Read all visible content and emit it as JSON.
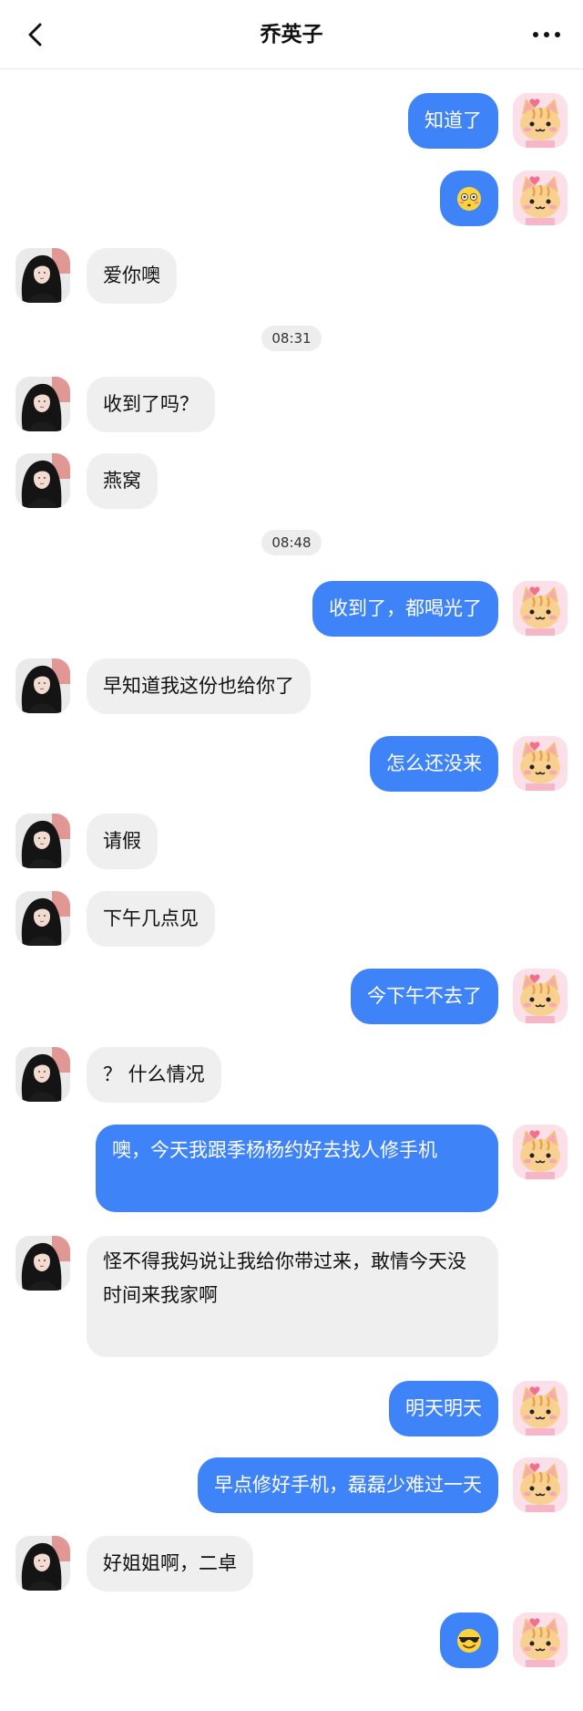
{
  "header": {
    "title": "乔英子"
  },
  "accent_color": "#3e83f8",
  "other_bubble_color": "#efefef",
  "messages": {
    "m1": "知道了",
    "m2_emoji": "flushed-face",
    "m3": "爱你噢",
    "t1": "08:31",
    "m4": "收到了吗？",
    "m5": "燕窝",
    "t2": "08:48",
    "m6": "收到了，都喝光了",
    "m7": "早知道我这份也给你了",
    "m8": "怎么还没来",
    "m9": "请假",
    "m10": "下午几点见",
    "m11": "今下午不去了",
    "m12": "？ 什么情况",
    "m13": "噢，今天我跟季杨杨约好去找人修手机",
    "m14": "怪不得我妈说让我给你带过来，敢情今天没时间来我家啊",
    "m15": "明天明天",
    "m16": "早点修好手机，磊磊少难过一天",
    "m17": "好姐姐啊，二卓",
    "m18_emoji": "sunglasses-face"
  }
}
